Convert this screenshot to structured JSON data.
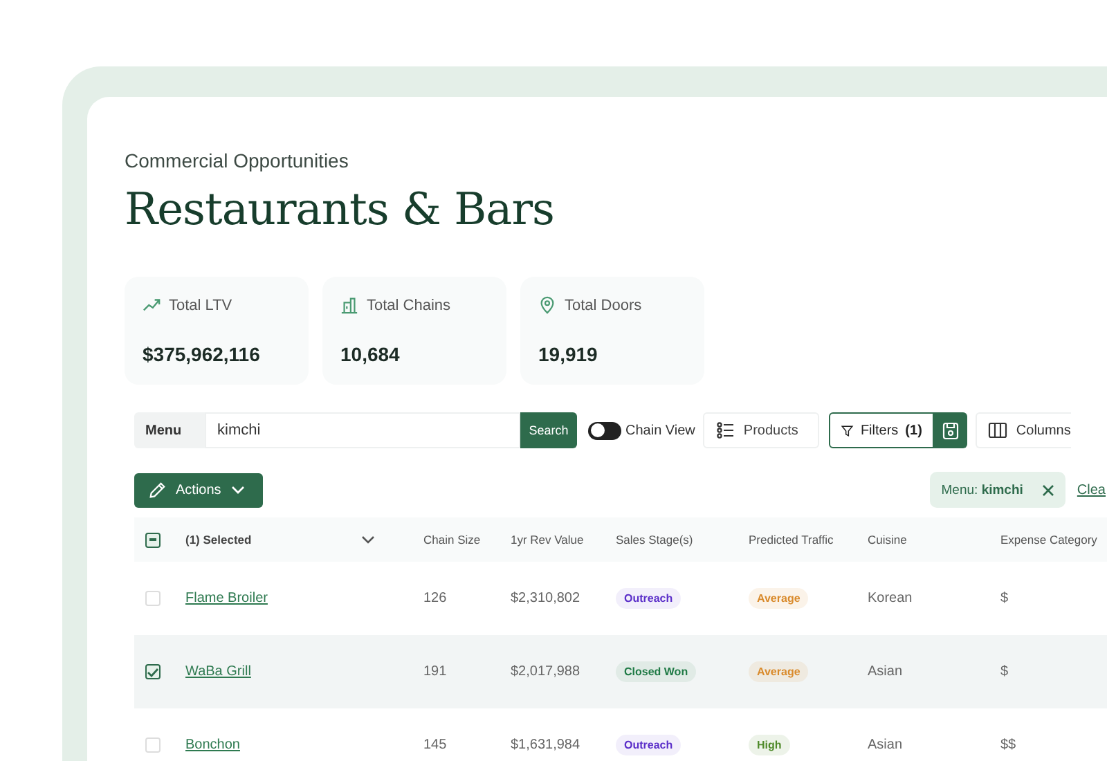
{
  "breadcrumb": "Commercial Opportunities",
  "title": "Restaurants & Bars",
  "stats": [
    {
      "kind": "trend",
      "label": "Total LTV",
      "value": "$375,962,116"
    },
    {
      "kind": "building",
      "label": "Total Chains",
      "value": "10,684"
    },
    {
      "kind": "pin",
      "label": "Total Doors",
      "value": "19,919"
    }
  ],
  "toolbar": {
    "search_scope": "Menu",
    "search_value": "kimchi",
    "search_button": "Search",
    "chain_view": {
      "label": "Chain View",
      "on": false
    },
    "products": "Products",
    "filters": "Filters",
    "filters_count": "(1)",
    "columns": "Columns"
  },
  "actions": "Actions",
  "active_filter": {
    "label": "Menu:",
    "value": "kimchi"
  },
  "clear_link": "Clea",
  "table": {
    "select_all_partial": true,
    "selection_label": "(1) Selected",
    "columns": [
      "Chain Size",
      "1yr Rev Value",
      "Sales Stage(s)",
      "Predicted Traffic",
      "Cuisine",
      "Expense Category"
    ],
    "rows": [
      {
        "selected": false,
        "name": "Flame Broiler",
        "chain_size": "126",
        "revenue": "$2,310,802",
        "stage": {
          "text": "Outreach",
          "color": "#5b2fc9"
        },
        "traffic": {
          "text": "Average",
          "color": "#d98a2b"
        },
        "cuisine": "Korean",
        "expense": "$"
      },
      {
        "selected": true,
        "name": "WaBa Grill",
        "chain_size": "191",
        "revenue": "$2,017,988",
        "stage": {
          "text": "Closed Won",
          "color": "#1f7a45"
        },
        "traffic": {
          "text": "Average",
          "color": "#d98a2b"
        },
        "cuisine": "Asian",
        "expense": "$"
      },
      {
        "selected": false,
        "name": "Bonchon",
        "chain_size": "145",
        "revenue": "$1,631,984",
        "stage": {
          "text": "Outreach",
          "color": "#5b2fc9"
        },
        "traffic": {
          "text": "High",
          "color": "#4f8a2a"
        },
        "cuisine": "Asian",
        "expense": "$$"
      }
    ]
  }
}
